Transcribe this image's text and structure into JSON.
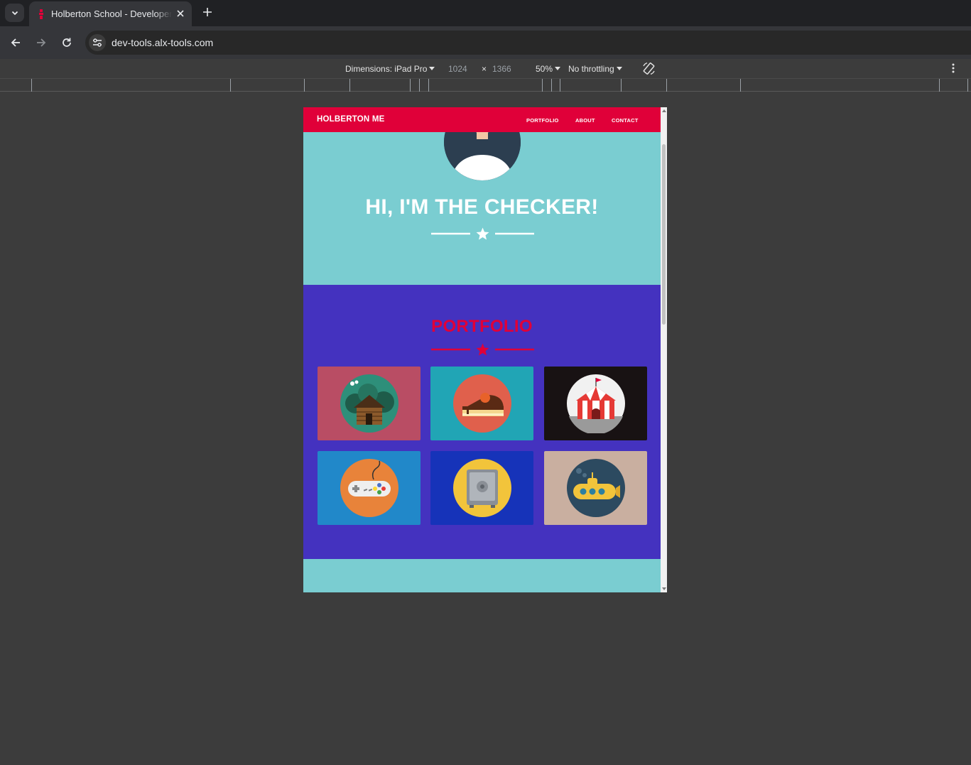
{
  "browser": {
    "tab_title": "Holberton School - Developer tools",
    "url": "dev-tools.alx-tools.com"
  },
  "devtools": {
    "dimensions_label": "Dimensions: iPad Pro",
    "width": "1024",
    "times": "×",
    "height": "1366",
    "zoom": "50%",
    "throttling": "No throttling"
  },
  "site": {
    "brand": "HOLBERTON ME",
    "nav": [
      "PORTFOLIO",
      "ABOUT",
      "CONTACT"
    ],
    "hero_title": "HI, I'M THE CHECKER!",
    "portfolio_title": "PORTFOLIO",
    "colors": {
      "primary_red": "#e00039",
      "hero_teal": "#7acdd1",
      "portfolio_purple": "#4432bf"
    },
    "portfolio_items": [
      {
        "icon": "cabin-icon",
        "background": "#b94d64"
      },
      {
        "icon": "cake-icon",
        "background": "#21a5b5"
      },
      {
        "icon": "circus-tent-icon",
        "background": "#181213"
      },
      {
        "icon": "game-controller-icon",
        "background": "#2188c9"
      },
      {
        "icon": "safe-icon",
        "background": "#1633b9"
      },
      {
        "icon": "submarine-icon",
        "background": "#c9afa0"
      }
    ]
  }
}
